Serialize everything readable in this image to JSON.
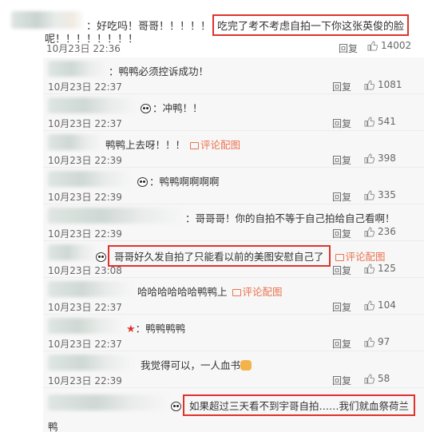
{
  "main_comment": {
    "text_prefix": "：好吃吗！哥哥！！！！！",
    "highlight": "吃完了考不考虑自拍一下你这张英俊的脸",
    "text_cont": "呢！！！！！！！！",
    "date": "10月23日 22:36",
    "reply_label": "回复",
    "likes": "14002"
  },
  "replies": [
    {
      "text": "：鸭鸭必须控诉成功！",
      "date": "10月23日 22:37",
      "reply_label": "回复",
      "likes": "1081"
    },
    {
      "text": "：冲鸭！！",
      "date": "10月23日 22:37",
      "reply_label": "回复",
      "likes": "541"
    },
    {
      "text": "鸭鸭上去呀！！！",
      "pic_link": "评论配图",
      "date": "10月23日 22:39",
      "reply_label": "回复",
      "likes": "398"
    },
    {
      "text": "：鸭鸭啊啊啊啊",
      "date": "10月23日 22:39",
      "reply_label": "回复",
      "likes": "335"
    },
    {
      "text": "：哥哥哥！你的自拍不等于自己拍给自己看啊！",
      "date": "10月23日 22:39",
      "reply_label": "回复",
      "likes": "236"
    },
    {
      "highlight": "哥哥好久发自拍了只能看以前的美图安慰自己了",
      "pic_link": "评论配图",
      "date": "10月23日 23:08",
      "reply_label": "回复",
      "likes": "125"
    },
    {
      "text": "哈哈哈哈哈哈鸭鸭上",
      "pic_link": "评论配图",
      "date": "10月23日 22:37",
      "reply_label": "回复",
      "likes": "104"
    },
    {
      "text": "：鸭鸭鸭鸭",
      "date": "10月23日 22:37",
      "reply_label": "回复",
      "likes": "97"
    },
    {
      "text": "我觉得可以，一人血书",
      "date": "10月23日 22:39",
      "reply_label": "回复",
      "likes": "58"
    },
    {
      "highlight": "如果超过三天看不到宇哥自拍……我们就血祭荷兰",
      "text_cont": "鸭"
    }
  ]
}
